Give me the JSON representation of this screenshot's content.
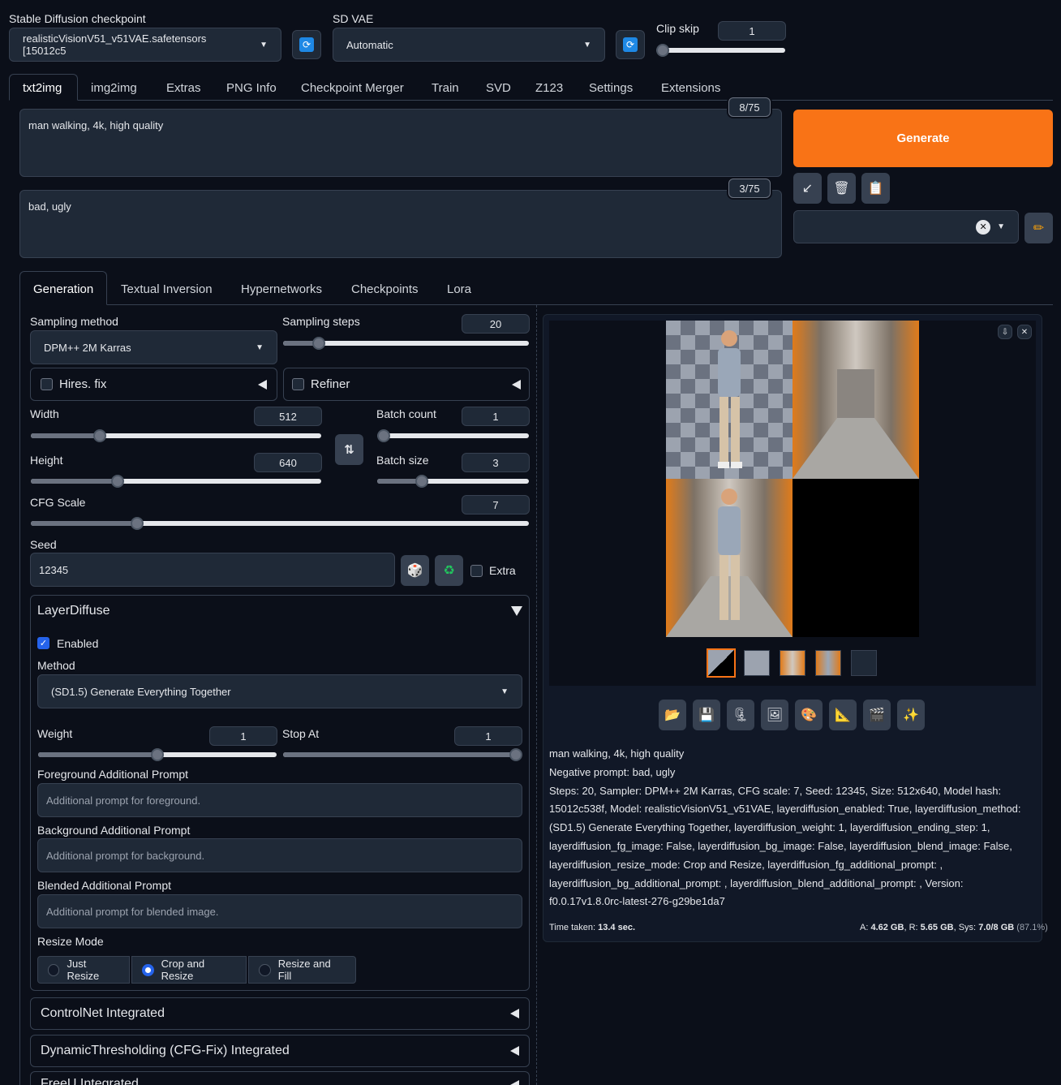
{
  "top": {
    "checkpoint_label": "Stable Diffusion checkpoint",
    "checkpoint_value": "realisticVisionV51_v51VAE.safetensors [15012c5",
    "vae_label": "SD VAE",
    "vae_value": "Automatic",
    "clip_skip_label": "Clip skip",
    "clip_skip_value": "1"
  },
  "tabs": [
    "txt2img",
    "img2img",
    "Extras",
    "PNG Info",
    "Checkpoint Merger",
    "Train",
    "SVD",
    "Z123",
    "Settings",
    "Extensions"
  ],
  "prompt": {
    "positive": "man walking, 4k, high quality",
    "positive_count": "8/75",
    "negative": "bad, ugly",
    "negative_count": "3/75"
  },
  "generate_label": "Generate",
  "subtabs": [
    "Generation",
    "Textual Inversion",
    "Hypernetworks",
    "Checkpoints",
    "Lora"
  ],
  "generation": {
    "sampling_method_label": "Sampling method",
    "sampling_method_value": "DPM++ 2M Karras",
    "sampling_steps_label": "Sampling steps",
    "sampling_steps_value": "20",
    "hires_label": "Hires. fix",
    "refiner_label": "Refiner",
    "width_label": "Width",
    "width_value": "512",
    "height_label": "Height",
    "height_value": "640",
    "batch_count_label": "Batch count",
    "batch_count_value": "1",
    "batch_size_label": "Batch size",
    "batch_size_value": "3",
    "cfg_label": "CFG Scale",
    "cfg_value": "7",
    "seed_label": "Seed",
    "seed_value": "12345",
    "extra_label": "Extra"
  },
  "layerdiffuse": {
    "title": "LayerDiffuse",
    "enabled_label": "Enabled",
    "method_label": "Method",
    "method_value": "(SD1.5) Generate Everything Together",
    "weight_label": "Weight",
    "weight_value": "1",
    "stop_at_label": "Stop At",
    "stop_at_value": "1",
    "fg_label": "Foreground Additional Prompt",
    "fg_placeholder": "Additional prompt for foreground.",
    "bg_label": "Background Additional Prompt",
    "bg_placeholder": "Additional prompt for background.",
    "blend_label": "Blended Additional Prompt",
    "blend_placeholder": "Additional prompt for blended image.",
    "resize_label": "Resize Mode",
    "resize_options": [
      "Just Resize",
      "Crop and Resize",
      "Resize and Fill"
    ]
  },
  "sections": [
    "ControlNet Integrated",
    "DynamicThresholding (CFG-Fix) Integrated",
    "FreeU Integrated"
  ],
  "output": {
    "info_prompt": "man walking, 4k, high quality",
    "info_negative": "Negative prompt: bad, ugly",
    "info_params": "Steps: 20, Sampler: DPM++ 2M Karras, CFG scale: 7, Seed: 12345, Size: 512x640, Model hash: 15012c538f, Model: realisticVisionV51_v51VAE, layerdiffusion_enabled: True, layerdiffusion_method: (SD1.5) Generate Everything Together, layerdiffusion_weight: 1, layerdiffusion_ending_step: 1, layerdiffusion_fg_image: False, layerdiffusion_bg_image: False, layerdiffusion_blend_image: False, layerdiffusion_resize_mode: Crop and Resize, layerdiffusion_fg_additional_prompt: , layerdiffusion_bg_additional_prompt: , layerdiffusion_blend_additional_prompt: , Version: f0.0.17v1.8.0rc-latest-276-g29be1da7",
    "time_label": "Time taken:",
    "time_value": "13.4 sec.",
    "mem_a_label": "A:",
    "mem_a": "4.62 GB",
    "mem_r_label": "R:",
    "mem_r": "5.65 GB",
    "mem_sys_label": "Sys:",
    "mem_sys": "7.0/8 GB",
    "mem_pct": "(87.1%)"
  },
  "colors": {
    "generate": "#f97316",
    "accent": "#2563eb",
    "background": "#0b0f19"
  }
}
